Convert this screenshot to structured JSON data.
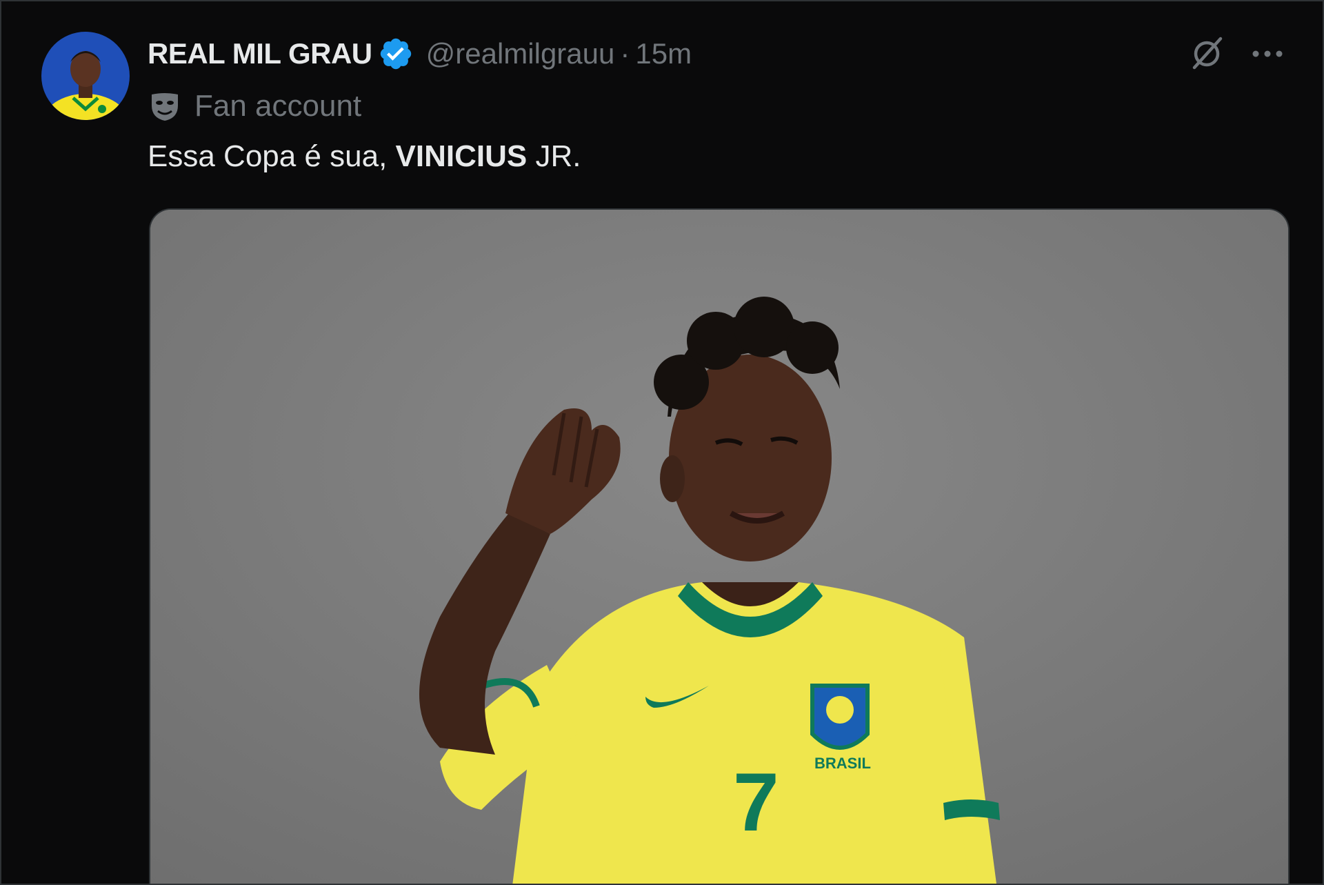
{
  "tweet": {
    "author": {
      "display_name": "REAL MIL GRAU",
      "verified": true,
      "handle": "@realmilgrauu",
      "separator": "·",
      "time": "15m",
      "avatar_icon": "avatar-player-illustration"
    },
    "account_label": {
      "icon": "mask-icon",
      "text": "Fan account"
    },
    "text": {
      "part1": "Essa Copa é sua, ",
      "bold": "VINICIUS",
      "part2": " JR."
    },
    "actions": {
      "grok_icon": "grok-icon",
      "more_icon": "more-options-icon"
    },
    "media": {
      "jersey": {
        "brand_text": "BRASIL",
        "number": "7"
      }
    }
  },
  "colors": {
    "background": "#0a0a0b",
    "text_primary": "#e7e9ea",
    "text_secondary": "#71767b",
    "verified_blue": "#1d9bf0",
    "jersey_yellow": "#f2e94a",
    "jersey_green": "#0f7a5a"
  }
}
